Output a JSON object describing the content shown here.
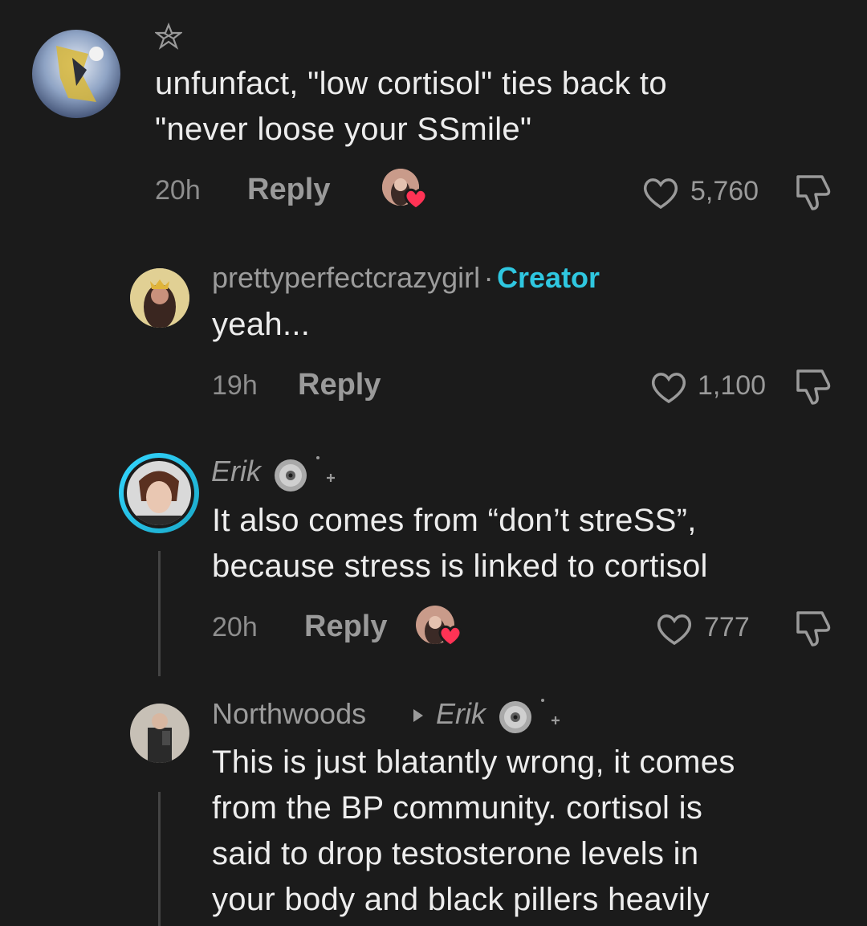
{
  "comments": [
    {
      "text_lines": [
        "unfunfact, \"low cortisol\" ties back to",
        "\"never loose your SSmile\""
      ],
      "time": "20h",
      "reply_label": "Reply",
      "likes": "5,760"
    },
    {
      "username": "prettyperfectcrazygirl",
      "separator": "·",
      "badge": "Creator",
      "text_lines": [
        "yeah..."
      ],
      "time": "19h",
      "reply_label": "Reply",
      "likes": "1,100"
    },
    {
      "username": "Erik",
      "text_lines": [
        "It also comes from “don’t streSS”,",
        "because stress is linked to cortisol"
      ],
      "time": "20h",
      "reply_label": "Reply",
      "likes": "777"
    },
    {
      "username": "Northwoods",
      "reply_to": "Erik",
      "text_lines": [
        "This is just blatantly wrong, it comes",
        "from the BP community. cortisol is",
        "said to drop testosterone levels in",
        "your body and black pillers heavily"
      ]
    }
  ],
  "colors": {
    "background": "#1b1b1b",
    "creator_badge": "#2fc7e0",
    "liked_heart": "#ff3355"
  }
}
